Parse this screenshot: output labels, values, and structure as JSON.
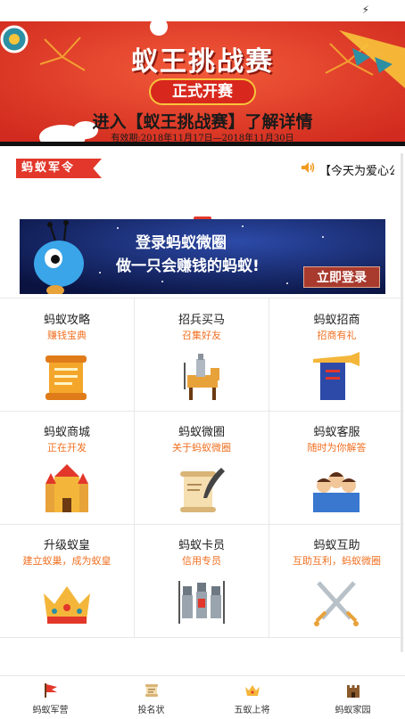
{
  "status_bar": {
    "charging_icon": "charging-bolt-icon"
  },
  "banner": {
    "title": "蚁王挑战赛",
    "badge": "正式开赛",
    "cta": "进入【蚁王挑战赛】了解详情",
    "validity": "有效期:2018年11月17日—2018年11月30日"
  },
  "notice": {
    "tag": "蚂蚁军令",
    "ticker": "【今天为爱心公益日】",
    "speaker_icon": "speaker-icon"
  },
  "ad": {
    "line1": "登录蚂蚁微圈",
    "line2": "做一只会赚钱的蚂蚁!",
    "button": "立即登录"
  },
  "grid": [
    {
      "title": "蚂蚁攻略",
      "subtitle": "赚钱宝典",
      "icon": "scroll-icon"
    },
    {
      "title": "招兵买马",
      "subtitle": "召集好友",
      "icon": "knight-horse-icon"
    },
    {
      "title": "蚂蚁招商",
      "subtitle": "招商有礼",
      "icon": "trumpet-banner-icon"
    },
    {
      "title": "蚂蚁商城",
      "subtitle": "正在开发",
      "icon": "castle-icon"
    },
    {
      "title": "蚂蚁微圈",
      "subtitle": "关于蚂蚁微圈",
      "icon": "quill-scroll-icon"
    },
    {
      "title": "蚂蚁客服",
      "subtitle": "随时为你解答",
      "icon": "service-people-icon"
    },
    {
      "title": "升级蚁皇",
      "subtitle": "建立蚁巢，成为蚁皇",
      "icon": "crown-icon"
    },
    {
      "title": "蚂蚁卡员",
      "subtitle": "信用专员",
      "icon": "soldiers-icon"
    },
    {
      "title": "蚂蚁互助",
      "subtitle": "互助互利，蚂蚁微圈",
      "icon": "crossed-swords-icon"
    }
  ],
  "tabs": [
    {
      "label": "蚂蚁军营",
      "icon": "flag-icon"
    },
    {
      "label": "投名状",
      "icon": "scroll-tab-icon"
    },
    {
      "label": "五蚁上将",
      "icon": "crown-tab-icon"
    },
    {
      "label": "蚂蚁家园",
      "icon": "castle-tab-icon"
    }
  ],
  "colors": {
    "accent": "#e2372a",
    "subtitle": "#f07022"
  }
}
